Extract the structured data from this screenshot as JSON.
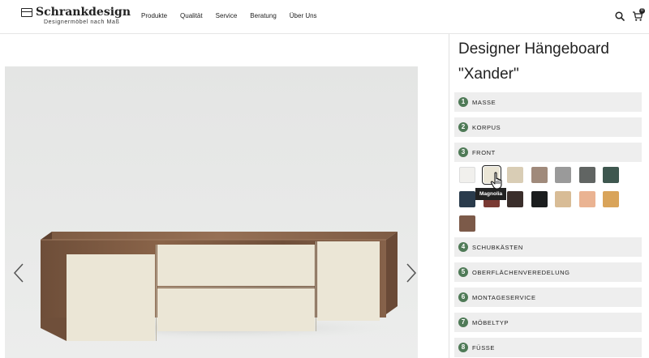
{
  "brand": {
    "name": "Schrankdesign",
    "tagline": "Designermöbel nach Maß"
  },
  "nav": [
    {
      "label": "Produkte"
    },
    {
      "label": "Qualität"
    },
    {
      "label": "Service"
    },
    {
      "label": "Beratung"
    },
    {
      "label": "Über Uns"
    }
  ],
  "header": {
    "search_icon": "search-icon",
    "cart_icon": "cart-icon",
    "cart_count": "0"
  },
  "product": {
    "title": "Designer Hängeboard \"Xander\""
  },
  "steps": [
    {
      "num": "1",
      "label": "MASSE"
    },
    {
      "num": "2",
      "label": "KORPUS"
    },
    {
      "num": "3",
      "label": "FRONT"
    },
    {
      "num": "4",
      "label": "SCHUBKÄSTEN"
    },
    {
      "num": "5",
      "label": "OBERFLÄCHENVEREDELUNG"
    },
    {
      "num": "6",
      "label": "MONTAGESERVICE"
    },
    {
      "num": "7",
      "label": "MÖBELTYP"
    },
    {
      "num": "8",
      "label": "FÜSSE"
    }
  ],
  "front_swatches": [
    {
      "color": "#f1f0ed",
      "selected": false
    },
    {
      "color": "#ebe6d6",
      "selected": true
    },
    {
      "color": "#d9cdb5",
      "selected": false
    },
    {
      "color": "#a08a7b",
      "selected": false
    },
    {
      "color": "#9a9a9a",
      "selected": false
    },
    {
      "color": "#616563",
      "selected": false
    },
    {
      "color": "#3e574f",
      "selected": false
    },
    {
      "color": "#2a3b4c",
      "selected": false
    },
    {
      "color": "#7a3a33",
      "selected": false
    },
    {
      "color": "#3a2e2b",
      "selected": false
    },
    {
      "color": "#1b1d1e",
      "selected": false
    },
    {
      "color": "#d8bc96",
      "selected": false
    },
    {
      "color": "#eab392",
      "selected": false
    },
    {
      "color": "#d9a45a",
      "selected": false
    },
    {
      "color": "#7c5a49",
      "selected": false
    }
  ],
  "tooltip": {
    "label": "Magnolia"
  },
  "viewer": {
    "prev_icon": "chevron-left-icon",
    "next_icon": "chevron-right-icon",
    "product_color": "#ebe6d6",
    "wood_color": "#7a5a43"
  }
}
